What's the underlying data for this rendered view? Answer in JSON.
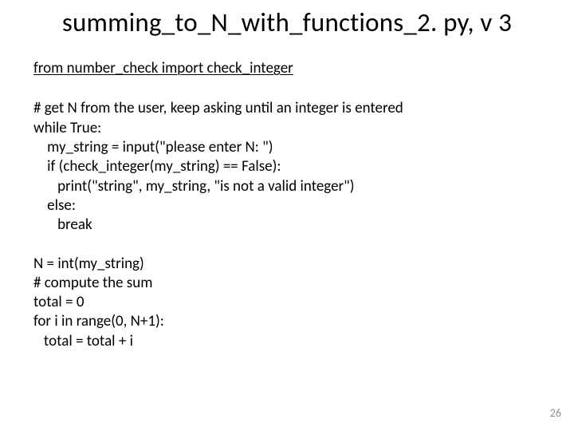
{
  "title": "summing_to_N_with_functions_2. py, v 3",
  "import_line": "from number_check import check_integer",
  "code_block_1": "# get N from the user, keep asking until an integer is entered\nwhile True:\n    my_string = input(\"please enter N: \")\n    if (check_integer(my_string) == False):\n       print(\"string\", my_string, \"is not a valid integer\")\n    else:\n       break",
  "code_block_2": "N = int(my_string)\n# compute the sum\ntotal = 0\nfor i in range(0, N+1):\n   total = total + i",
  "page_number": "26"
}
